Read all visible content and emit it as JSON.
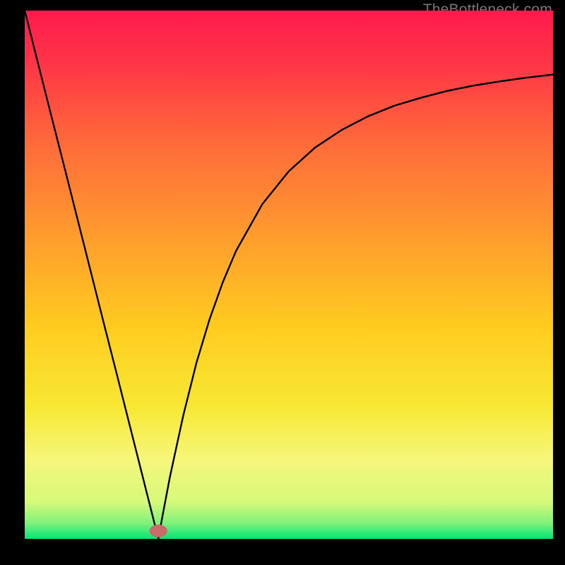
{
  "watermark": "TheBottleneck.com",
  "chart_data": {
    "type": "line",
    "title": "",
    "xlabel": "",
    "ylabel": "",
    "xlim": [
      0,
      100
    ],
    "ylim": [
      0,
      100
    ],
    "grid": false,
    "legend": false,
    "axes_visible": false,
    "background_gradient": {
      "stops": [
        {
          "offset": 0.0,
          "color": "#ff1a4d"
        },
        {
          "offset": 0.1,
          "color": "#ff3547"
        },
        {
          "offset": 0.25,
          "color": "#ff6a3a"
        },
        {
          "offset": 0.42,
          "color": "#ff9a2e"
        },
        {
          "offset": 0.6,
          "color": "#ffcc1f"
        },
        {
          "offset": 0.75,
          "color": "#f7e833"
        },
        {
          "offset": 0.85,
          "color": "#f6f67a"
        },
        {
          "offset": 0.93,
          "color": "#d6f97a"
        },
        {
          "offset": 0.97,
          "color": "#80f27b"
        },
        {
          "offset": 1.0,
          "color": "#00e676"
        }
      ]
    },
    "marker": {
      "x": 25.3,
      "y": 1.5,
      "color": "#c96b6b",
      "rx": 1.7,
      "ry": 1.2
    },
    "series": [
      {
        "name": "curve",
        "type": "line",
        "color": "#000000",
        "stroke_width": 2,
        "x": [
          0.0,
          2.5,
          5.0,
          7.5,
          10.0,
          12.5,
          15.0,
          17.5,
          20.0,
          22.5,
          25.0,
          25.3,
          26.0,
          27.5,
          30.0,
          32.5,
          35.0,
          37.5,
          40.0,
          45.0,
          50.0,
          55.0,
          60.0,
          65.0,
          70.0,
          75.0,
          80.0,
          85.0,
          90.0,
          95.0,
          100.0
        ],
        "y": [
          100.0,
          90.1,
          80.2,
          70.4,
          60.5,
          50.6,
          40.7,
          30.9,
          21.0,
          11.1,
          1.2,
          0.0,
          3.9,
          11.8,
          23.3,
          33.3,
          41.6,
          48.6,
          54.5,
          63.4,
          69.6,
          74.1,
          77.4,
          80.0,
          82.0,
          83.5,
          84.8,
          85.8,
          86.6,
          87.3,
          87.9
        ]
      }
    ]
  }
}
